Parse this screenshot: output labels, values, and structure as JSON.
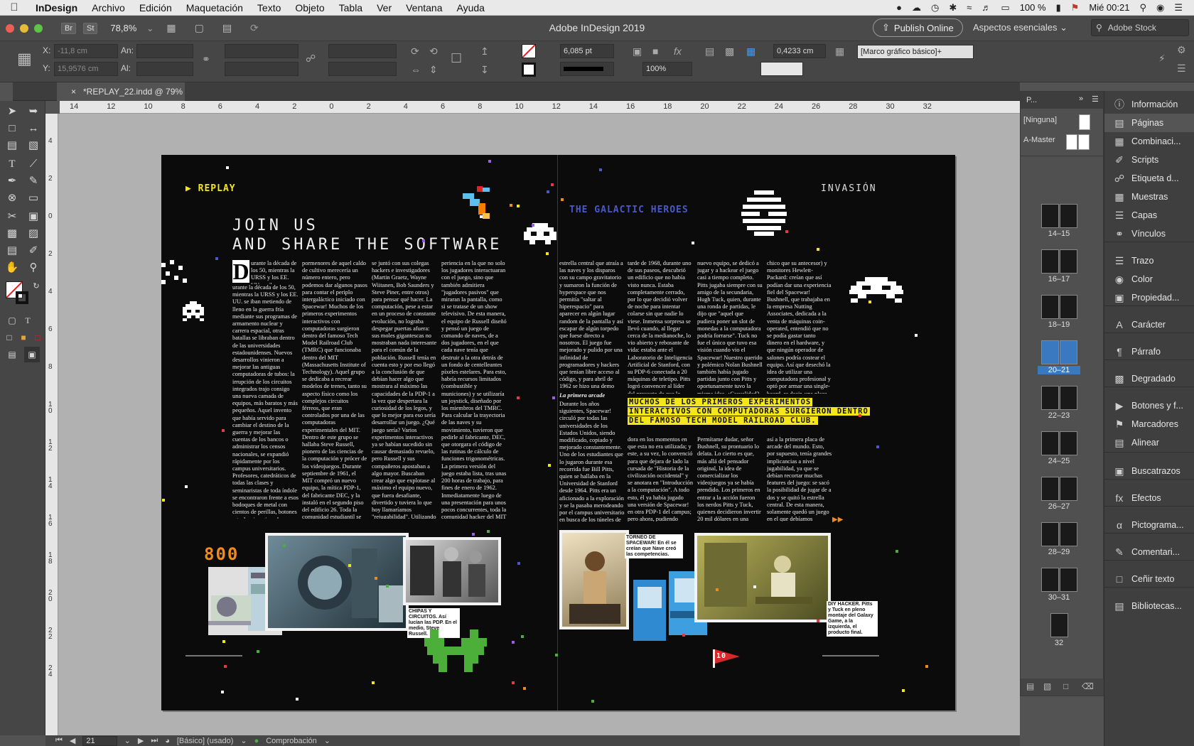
{
  "menubar": {
    "app": "InDesign",
    "items": [
      "Archivo",
      "Edición",
      "Maquetación",
      "Texto",
      "Objeto",
      "Tabla",
      "Ver",
      "Ventana",
      "Ayuda"
    ],
    "battery": "100 %",
    "clock": "Mié 00:21"
  },
  "appbar": {
    "chip_br": "Br",
    "chip_st": "St",
    "zoom": "78,8%",
    "title": "Adobe InDesign 2019",
    "publish": "Publish Online",
    "workspace": "Aspectos esenciales",
    "search_placeholder": "Adobe Stock"
  },
  "control": {
    "x_label": "X:",
    "x_value": "-11,8 cm",
    "y_label": "Y:",
    "y_value": "15,9576 cm",
    "w_label": "An:",
    "h_label": "Al:",
    "stroke_weight": "6,085 pt",
    "scale_pct": "100%",
    "offset": "0,4233 cm",
    "object_style": "[Marco gráfico básico]+"
  },
  "tab": {
    "close": "×",
    "title": "*REPLAY_22.indd @ 79%"
  },
  "ruler": {
    "h_labels": [
      "14",
      "12",
      "10",
      "8",
      "6",
      "4",
      "2",
      "0",
      "2",
      "4",
      "6",
      "8",
      "10",
      "12",
      "14",
      "16",
      "18",
      "20",
      "22",
      "24",
      "26",
      "28",
      "30",
      "32"
    ],
    "v_labels": [
      "4",
      "2",
      "0",
      "2",
      "4",
      "6",
      "8",
      "1 0",
      "1 2",
      "1 4",
      "1 6",
      "1 8",
      "2 0",
      "2 2",
      "2 4"
    ]
  },
  "spread": {
    "left_header": "REPLAY",
    "right_header": "INVASIÓN",
    "title_line1": "JOIN US",
    "title_line2": "AND SHARE THE SOFTWARE",
    "galactic": "THE GALACTIC HEROES",
    "drop_cap": "D",
    "col1": "urante la década de los 50, mientras la URSS y los EE. UU. se iban metiendo de lleno en la guerra fría mediante sus programas de armamento nuclear y carrera espacial, otras batallas se libraban dentro de las universidades estadounidenses. Nuevos desarrollos vinieron a mejorar las antiguas computadoras de tubos: la irrupción de los circuitos integrados trajo consigo una nueva camada de equipos, más baratos y más pequeños. Aquel invento que había servido para cambiar el destino de la guerra y mejorar las cuentas de los bancos o administrar los censos nacionales, se expandió rápidamente por los campus universitarios. Profesores, catedráticos de todas las clases y seminaristas de toda índole se encontraron frente a esos bodoques de metal con cientos de perillas, botones y teclas, imaginando ansiosamente para qué podían ser utilizados. Todos sabían que tenían en sus manos una puerta inmensa de conocimiento, pero muy pocos tenían idea de cómo abrirla. Deteniendo en los",
    "col2": "pormenores de aquel caldo de cultivo merecería un número entero, pero podemos dar algunos pasos para contar el periplo intergaláctico iniciado con Spacewar! Muchos de los primeros experimentos interactivos con computadoras surgieron dentro del famoso Tech Model Railroad Club (TMRC) que funcionaba dentro del MIT (Massachusetts Institute of Technology). Aquel grupo se dedicaba a recrear modelos de trenes, tanto su aspecto físico como los complejos circuitos férreos, que eran controlados por una de las computadoras experimentales del MIT. Dentro de este grupo se hallaba Steve Russell, pionero de las ciencias de la computación y prócer de los videojuegos. Durante septiembre de 1961, el MIT compró un nuevo equipo, la mítica PDP-1, del fabricante DEC, y la instaló en el segundo piso del edificio 26. Toda la comunidad estudiantil se congregó ante este suceso único e inmediatamente comenzaron los desafíos para demostrar de qué era capaz esta máquina. Russell vio todo esto y",
    "col3": "se juntó con sus colegas hackers e investigadores (Martin Graetz, Wayne Wiitanen, Bob Saunders y Steve Piner, entre otros) para pensar qué hacer. La computación, pese a estar en un proceso de constante evolución, no lograba despegar puertas afuera: sus moles gigantescas no mostraban nada interesante para el común de la población. Russell tenía en cuenta esto y por eso llegó a la conclusión de que debían hacer algo que mostrara al máximo las capacidades de la PDP-1 a la vez que despertara la curiosidad de los legos, y que lo mejor para eso sería desarrollar un juego. ¿Qué juego sería? Varios experimentos interactivos ya se habían sucedido sin causar demasiado revuelo, pero Russell y sus compañeros apostaban a algo mayor. Buscaban crear algo que explotase al máximo el equipo nuevo, que fuera desafiante, divertido y tuviera lo que hoy llamaríamos \"rejugabilidad\". Utilizando el monitor de la computadora (un equipo que originalmente se utilizaba como monitor de radar), plantearon una ex-",
    "col4": "periencia en la que no solo los jugadores interactuaran con el juego, sino que también admitiera \"jugadores pasivos\" que miraran la pantalla, como si se tratase de un show televisivo. De esta manera, el equipo de Russell diseñó y pensó un juego de comando de naves, de a dos jugadores, en el que cada nave tenía que destruir a la otra detrás de un fondo de centelleantes píxeles estelares. Para esto, habría recursos limitados (combustible y municiones) y se utilizaría un joystick, diseñado por los miembros del TMRC. Para calcular la trayectoria de las naves y su movimiento, tuvieron que pedirle al fabricante, DEC, que otorgara el código de las rutinas de cálculo de funciones trigonométricas. La primera versión del juego estaba lista, tras unas 200 horas de trabajo, para fines de enero de 1962. Inmediatamente luego de una presentación para unos pocos concurrentes, toda la comunidad hacker del MIT quedó obnubilada ante este nuevo espectáculo e instantáneamente comenzaron a hackear el juego: agregaron una",
    "col5": "estrella central que atraía a las naves y los disparos con su campo gravitatorio y sumaron la función de hyperspace que nos permitía \"saltar al hiperespacio\" para aparecer en algún lugar random de la pantalla y así escapar de algún torpedo que fuese directo a nosotros. El juego fue mejorado y pulido por una infinidad de programadores y hackers que tenían libre acceso al código, y para abril de 1962 se hizo una demo abierta a la universidad, público en general y prensa.",
    "col5_sub": "La primera arcade",
    "col5b": "Durante los años siguientes, Spacewar! circuló por todas las universidades de los Estados Unidos, siendo modificado, copiado y mejorado constantemente. Uno de los estudiantes que lo jugaron durante esa recorrida fue Bill Pitts, quien se hallaba en la Universidad de Stanford desde 1964. Pitts era un aficionado a la exploración y se la pasaba merodeando por el campus universitario en busca de los túneles de las viejas tuberías de vapor que había en los subsuelos. Fue así como, en una",
    "col6": "tarde de 1968, durante uno de sus paseos, descubrió un edificio que no había visto nunca. Estaba completamente cerrado, por lo que decidió volver de noche para intentar colarse sin que nadie lo viese. Inmensa sorpresa se llevó cuando, al llegar cerca de la medianoche, lo vio abierto y rebosante de vida: estaba ante el Laboratorio de Inteligencia Artificial de Stanford, con su PDP-6 conectada a 20 máquinas de teletipo. Pitts logró convencer al líder del proyecto de que lo dejase usar la computa-",
    "col6b": "dora en los momentos en que esta no era utilizada; y este, a su vez, lo convenció para que dejara de lado la cursada de \"Historia de la civilización occidental\" y se anotara en \"Introducción a la computación\". A todo esto, él ya había jugado una versión de Spacewar! en otra PDP-1 del campus; pero ahora, pudiendo utilizar este",
    "col7": "nuevo equipo, se dedicó a jugar y a hackear el juego casi a tiempo completo. Pitts jugaba siempre con su amigo de la secundaria, Hugh Tuck, quien, durante una ronda de partidas, le dijo que \"aquel que pudiera poner un slot de monedas a la computadora podría forrarse\". Tuck no fue el único que tuvo esa visión cuando vio el Spacewar! Nuestro querido y polémico Nolan Bushnell también había jugado partidas junto con Pitts y oportunamente tuvo la misma idea. ¿Casualidad?",
    "col7b": "Permítame dudar, señor Bushnell, su prontuario lo delata. Lo cierto es que, más allá del pensador original, la idea de comercializar los videojuegos ya se había prendido. Los primeros en entrar a la acción fueron los nerdos Pitts y Tuck, quienes decidieron invertir 20 mil dólares en una PDP-11 (modelo más económico y",
    "col8": "chico que su antecesor) y monitores Hewlett-Packard: creían que así podían dar una experiencia fiel del Spacewar! Bushnell, que trabajaba en la empresa Nutting Associates, dedicada a la venta de máquinas coin-operated, entendió que no se podía gastar tanto dinero en el hardware, y que ningún operador de salones podría costear el equipo. Así que desechó la idea de utilizar una computadora profesional y optó por armar una single-board, es decir, una placa única y custom, dando vida",
    "col8b": "así a la primera placa de arcade del mundo. Esto, por supuesto, tenía grandes implicancias a nivel jugabilidad, ya que se debían recortar muchas features del juego: se sacó la posibilidad de jugar de a dos y se quitó la estrella central. De esta manera, solamente quedó un juego en el que debíamos disparar a dos platillos",
    "pullquote": "MUCHOS DE LOS PRIMEROS EXPERIMENTOS INTERACTIVOS CON COMPUTADORAS SURGIERON DENTRO DEL FAMOSO TECH MODEL RAILROAD CLUB.",
    "score": "800",
    "cap1": "CHIPAS Y CIRCUITOS. Así lucían las PDP. En el medio, Steve Russell.",
    "cap2": "TORNEO DE SPACEWAR! En él se creían que Nave creó las competencias.",
    "cap3": "DIY HACKER. Pitts y Tuck en pleno montaje del Galaxy Game, a la izquierda, el producto final.",
    "flag_num": "10"
  },
  "pages_panel": {
    "tab": "P...",
    "none": "[Ninguna]",
    "master": "A-Master",
    "spreads": [
      "14–15",
      "16–17",
      "18–19",
      "20–21",
      "22–23",
      "24–25",
      "26–27",
      "28–29",
      "30–31",
      "32"
    ],
    "selected": "20–21"
  },
  "side_panel": {
    "items": [
      "Información",
      "Páginas",
      "Combinaci...",
      "Scripts",
      "Etiqueta d...",
      "Muestras",
      "Capas",
      "Vínculos",
      "Trazo",
      "Color",
      "Propiedad...",
      "Carácter",
      "Párrafo",
      "Degradado",
      "Botones y f...",
      "Marcadores",
      "Alinear",
      "Buscatrazos",
      "Efectos",
      "Pictograma...",
      "Comentari...",
      "Ceñir texto",
      "Bibliotecas..."
    ]
  },
  "status": {
    "page": "21",
    "style": "[Básico] (usado)",
    "preflight": "Comprobación"
  },
  "colors": {
    "accent_yellow": "#f5e61a",
    "galactic_blue": "#4b58c9",
    "score_orange": "#f08a1c"
  }
}
